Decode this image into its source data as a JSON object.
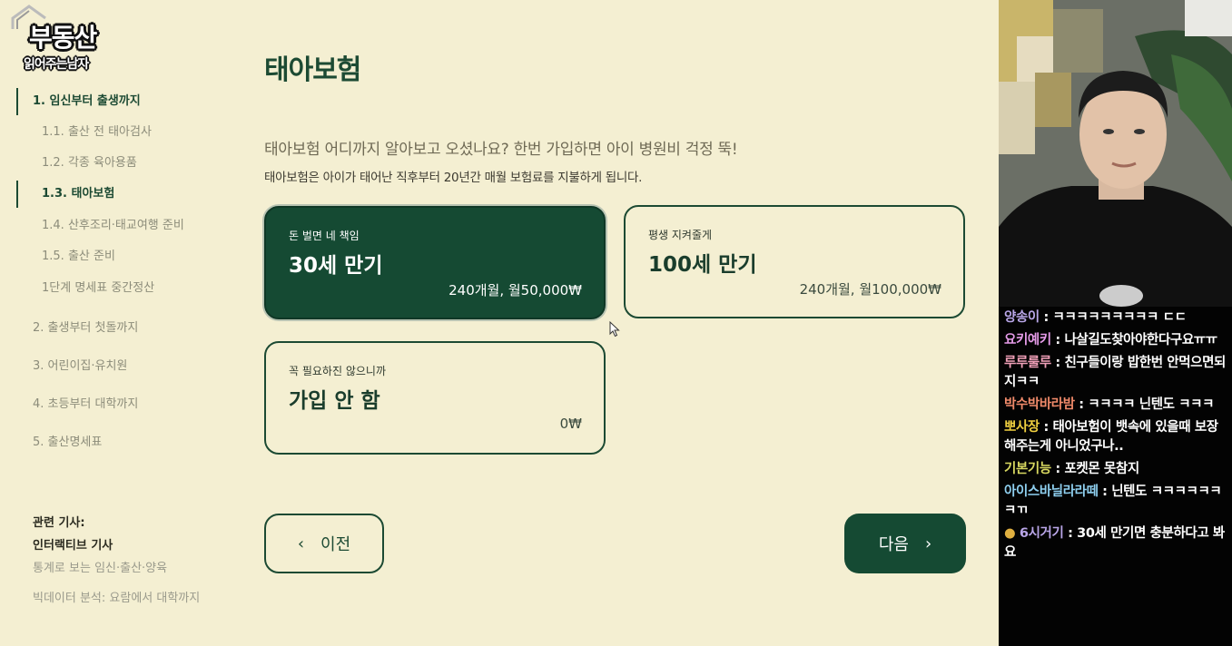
{
  "logo": {
    "line1": "부동산",
    "line2": "읽어주는남자"
  },
  "sidebar": {
    "items": [
      {
        "label": "1. 임신부터 출생까지",
        "active": true,
        "sub": false
      },
      {
        "label": "1.1. 출산 전 태아검사",
        "active": false,
        "sub": true
      },
      {
        "label": "1.2. 각종 육아용품",
        "active": false,
        "sub": true
      },
      {
        "label": "1.3. 태아보험",
        "active": true,
        "sub": true
      },
      {
        "label": "1.4. 산후조리·태교여행 준비",
        "active": false,
        "sub": true
      },
      {
        "label": "1.5. 출산 준비",
        "active": false,
        "sub": true
      },
      {
        "label": "1단계 명세표 중간정산",
        "active": false,
        "sub": true
      },
      {
        "label": "2. 출생부터 첫돌까지",
        "active": false,
        "sub": false
      },
      {
        "label": "3. 어린이집·유치원",
        "active": false,
        "sub": false
      },
      {
        "label": "4. 초등부터 대학까지",
        "active": false,
        "sub": false
      },
      {
        "label": "5. 출산명세표",
        "active": false,
        "sub": false
      }
    ],
    "related": {
      "heading": "관련 기사:",
      "link1": "인터랙티브 기사",
      "link2": "통계로 보는 임신·출산·양육",
      "link3": "빅데이터 분석: 요람에서 대학까지"
    }
  },
  "main": {
    "title": "태아보험",
    "intro": "태아보험 어디까지 알아보고 오셨나요? 한번 가입하면 아이 병원비 걱정 뚝!",
    "desc": "태아보험은 아이가 태어난 직후부터 20년간 매월 보험료를 지불하게 됩니다.",
    "options": [
      {
        "sub": "돈 벌면 네 책임",
        "main": "30세 만기",
        "price": "240개월, 월50,000₩",
        "selected": true
      },
      {
        "sub": "평생 지켜줄게",
        "main": "100세 만기",
        "price": "240개월, 월100,000₩",
        "selected": false
      },
      {
        "sub": "꼭 필요하진 않으니까",
        "main": "가입 안 함",
        "price": "0₩",
        "selected": false
      }
    ],
    "prev_label": "이전",
    "next_label": "다음"
  },
  "chat": {
    "messages": [
      {
        "user": "양송이",
        "text": "ㅋㅋㅋㅋㅋㅋㅋㅋㅋ ㄷㄷ",
        "color": "#b9a6e8"
      },
      {
        "user": "요키예키",
        "text": "나살길도찾아야한다구요ㅠㅠ",
        "color": "#e59be8"
      },
      {
        "user": "루루룰루",
        "text": "친구들이랑 밥한번 안먹으면되지ㅋㅋ",
        "color": "#f0a0b8"
      },
      {
        "user": "박수박바라밤",
        "text": "ㅋㅋㅋㅋ 닌텐도 ㅋㅋㅋ",
        "color": "#f08a6a"
      },
      {
        "user": "뽀사장",
        "text": "태아보험이 뱃속에 있을때 보장해주는게 아니었구나..",
        "color": "#f0d040"
      },
      {
        "user": "기본기능",
        "text": "포켓몬 못참지",
        "color": "#d8d860"
      },
      {
        "user": "아이스바닐라라떼",
        "text": "닌텐도 ㅋㅋㅋㅋㅋㅋㅋㄲ",
        "color": "#8fd0f0"
      },
      {
        "user": "6시거기",
        "text": "30세 만기면 충분하다고 봐요",
        "color": "#b9a6e8"
      }
    ]
  },
  "colors": {
    "accent": "#154a33",
    "page_bg": "#f4efd2"
  }
}
